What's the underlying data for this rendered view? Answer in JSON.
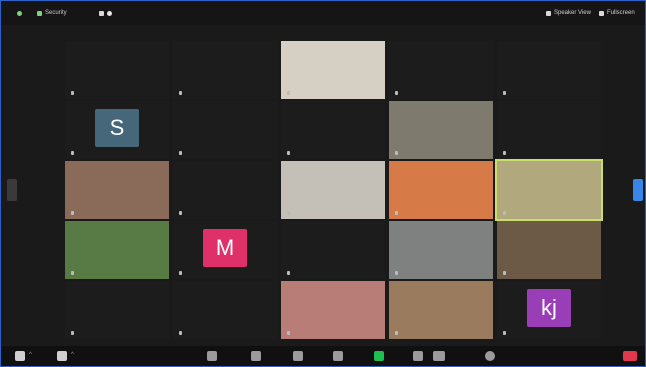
{
  "colors": {
    "border": "#2a62c9",
    "background": "#1a1a1a",
    "active_speaker": "#c8e06a",
    "end_button": "#e0394b",
    "share_button": "#1fbf4f",
    "arrow": "#3a86e8"
  },
  "topbar": {
    "left_items": [
      {
        "icon": "info-icon",
        "label": "i"
      },
      {
        "icon": "shield-icon",
        "label": "Security"
      },
      {
        "icon": "recording-icon",
        "label": ""
      }
    ],
    "right_items": [
      {
        "icon": "speaker-view-icon",
        "label": "Speaker View"
      },
      {
        "icon": "fullscreen-icon",
        "label": "Fullscreen"
      }
    ]
  },
  "participants": [
    {
      "name": "",
      "label": "",
      "type": "name",
      "avatar": ""
    },
    {
      "name": "",
      "label": "",
      "type": "name",
      "avatar": ""
    },
    {
      "name": "",
      "label": "",
      "type": "video",
      "color": "#d6d0c4"
    },
    {
      "name": "",
      "label": "",
      "type": "name",
      "avatar": ""
    },
    {
      "name": "",
      "label": "",
      "type": "name",
      "avatar": ""
    },
    {
      "name": "",
      "label": "",
      "type": "avatar",
      "avatar": "S",
      "color": "#46677a"
    },
    {
      "name": "",
      "label": "",
      "type": "name",
      "avatar": ""
    },
    {
      "name": "",
      "label": "",
      "type": "name",
      "avatar": ""
    },
    {
      "name": "",
      "label": "",
      "type": "video",
      "color": "#7f7a6e"
    },
    {
      "name": "",
      "label": "",
      "type": "name",
      "avatar": ""
    },
    {
      "name": "",
      "label": "",
      "type": "video",
      "color": "#8a6a58"
    },
    {
      "name": "",
      "label": "",
      "type": "name",
      "avatar": ""
    },
    {
      "name": "",
      "label": "",
      "type": "video",
      "color": "#c4c0b8"
    },
    {
      "name": "",
      "label": "",
      "type": "video",
      "color": "#d67a48"
    },
    {
      "name": "",
      "label": "",
      "type": "video",
      "color": "#b2a87e",
      "speaker": true
    },
    {
      "name": "",
      "label": "",
      "type": "video",
      "color": "#587a45"
    },
    {
      "name": "",
      "label": "",
      "type": "avatar",
      "avatar": "M",
      "color": "#e0306a"
    },
    {
      "name": "",
      "label": "",
      "type": "name",
      "avatar": ""
    },
    {
      "name": "",
      "label": "",
      "type": "video",
      "color": "#7e8180"
    },
    {
      "name": "",
      "label": "",
      "type": "video",
      "color": "#6d5a46"
    },
    {
      "name": "",
      "label": "",
      "type": "name",
      "avatar": ""
    },
    {
      "name": "",
      "label": "",
      "type": "name",
      "avatar": ""
    },
    {
      "name": "",
      "label": "",
      "type": "video",
      "color": "#b77d76"
    },
    {
      "name": "",
      "label": "",
      "type": "video",
      "color": "#9a7b5d"
    },
    {
      "name": "",
      "label": "",
      "type": "avatar",
      "avatar": "kj",
      "color": "#9a3eb7"
    }
  ],
  "toolbar": {
    "items": [
      {
        "icon": "mic-icon"
      },
      {
        "icon": "video-camera-icon"
      },
      {
        "icon": "security-icon"
      },
      {
        "icon": "participants-icon"
      },
      {
        "icon": "chat-icon"
      },
      {
        "icon": "share-screen-icon"
      },
      {
        "icon": "record-icon"
      },
      {
        "icon": "reactions-icon"
      },
      {
        "icon": "more-icon"
      },
      {
        "icon": "end-meeting-icon"
      }
    ]
  }
}
